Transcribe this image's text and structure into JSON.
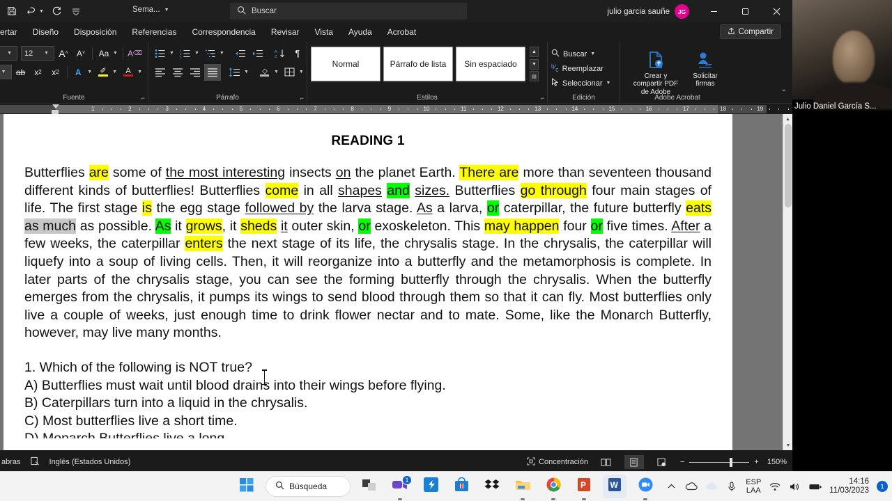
{
  "window": {
    "app": "Microsoft Word",
    "doc_title": "Sema...",
    "account_name": "julio garcia sauñe",
    "avatar_initials": "JG",
    "search_placeholder": "Buscar",
    "share_label": "Compartir",
    "minimize": "–",
    "restore": "❐",
    "close": "✕"
  },
  "tabs": [
    {
      "label": "sertar"
    },
    {
      "label": "Diseño"
    },
    {
      "label": "Disposición"
    },
    {
      "label": "Referencias"
    },
    {
      "label": "Correspondencia"
    },
    {
      "label": "Revisar"
    },
    {
      "label": "Vista"
    },
    {
      "label": "Ayuda"
    },
    {
      "label": "Acrobat"
    }
  ],
  "ribbon": {
    "font_group": {
      "label": "Fuente",
      "font_size": "12",
      "grow_font": "A",
      "shrink_font": "A",
      "change_case": "Aa",
      "clear_format": "A",
      "strikethrough": "ab",
      "subscript": "x₂",
      "superscript": "x²",
      "text_effects": "A",
      "highlight": "A",
      "font_color": "A"
    },
    "paragraph_group": {
      "label": "Párrafo"
    },
    "styles_group": {
      "label": "Estilos",
      "styles": [
        {
          "name": "Normal"
        },
        {
          "name": "Párrafo de lista"
        },
        {
          "name": "Sin espaciado"
        }
      ]
    },
    "edition_group": {
      "label": "Edición",
      "items": [
        {
          "label": "Buscar",
          "icon": "search-icon",
          "caret": true
        },
        {
          "label": "Reemplazar",
          "icon": "replace-icon",
          "caret": false
        },
        {
          "label": "Seleccionar",
          "icon": "select-icon",
          "caret": true
        }
      ]
    },
    "acrobat_group": {
      "label": "Adobe Acrobat",
      "buttons": [
        {
          "label": "Crear y compartir PDF de Adobe",
          "icon": "pdf-upload-icon"
        },
        {
          "label": "Solicitar firmas",
          "icon": "signature-icon"
        }
      ]
    }
  },
  "ruler": {
    "numbers": [
      "1",
      "2",
      "3",
      "4",
      "5",
      "6",
      "7",
      "8",
      "9",
      "10",
      "11",
      "12",
      "13",
      "14",
      "15",
      "16",
      "17",
      "18",
      "19"
    ]
  },
  "document": {
    "heading": "READING 1",
    "paragraph_runs": [
      {
        "t": "Butterflies ",
        "s": ""
      },
      {
        "t": "are",
        "s": "y"
      },
      {
        "t": " some of ",
        "s": ""
      },
      {
        "t": "the most interesting",
        "s": "u"
      },
      {
        "t": " insects ",
        "s": ""
      },
      {
        "t": "on",
        "s": "u"
      },
      {
        "t": " the planet Earth. ",
        "s": ""
      },
      {
        "t": "There are",
        "s": "y"
      },
      {
        "t": " more than seventeen thousand different kinds of butterflies! Butterflies ",
        "s": ""
      },
      {
        "t": "come",
        "s": "y"
      },
      {
        "t": " in all ",
        "s": ""
      },
      {
        "t": "shapes",
        "s": "u"
      },
      {
        "t": " ",
        "s": ""
      },
      {
        "t": "and",
        "s": "g"
      },
      {
        "t": " ",
        "s": ""
      },
      {
        "t": "sizes.",
        "s": "u"
      },
      {
        "t": " Butterflies ",
        "s": ""
      },
      {
        "t": "go through",
        "s": "y"
      },
      {
        "t": " four main stages of life. The first stage ",
        "s": ""
      },
      {
        "t": "is",
        "s": "y"
      },
      {
        "t": " the egg stage ",
        "s": ""
      },
      {
        "t": "followed by",
        "s": "u"
      },
      {
        "t": " the larva stage. ",
        "s": ""
      },
      {
        "t": "As",
        "s": "u"
      },
      {
        "t": " a larva, ",
        "s": ""
      },
      {
        "t": "or",
        "s": "g"
      },
      {
        "t": " caterpillar, the future butterfly ",
        "s": ""
      },
      {
        "t": "eats",
        "s": "y"
      },
      {
        "t": " ",
        "s": ""
      },
      {
        "t": "as much",
        "s": "gr"
      },
      {
        "t": " as possible. ",
        "s": ""
      },
      {
        "t": "As",
        "s": "g"
      },
      {
        "t": " it ",
        "s": ""
      },
      {
        "t": "grows",
        "s": "y"
      },
      {
        "t": ", it ",
        "s": ""
      },
      {
        "t": "sheds",
        "s": "y"
      },
      {
        "t": " ",
        "s": ""
      },
      {
        "t": "it",
        "s": "u"
      },
      {
        "t": " outer skin, ",
        "s": ""
      },
      {
        "t": "or",
        "s": "g"
      },
      {
        "t": " exoskeleton. This ",
        "s": ""
      },
      {
        "t": "may happen",
        "s": "y"
      },
      {
        "t": " four ",
        "s": ""
      },
      {
        "t": "or",
        "s": "g"
      },
      {
        "t": " five times. ",
        "s": ""
      },
      {
        "t": "After",
        "s": "u"
      },
      {
        "t": " a few weeks, the caterpillar ",
        "s": ""
      },
      {
        "t": "enters",
        "s": "y"
      },
      {
        "t": " the next stage of its life, the chrysalis stage. In the chrysalis, the caterpillar will liquefy into a soup of living cells. Then, it will reorganize into a butterfly and the metamorphosis is complete. In later parts of the chrysalis stage, you can see the forming butterfly through the chrysalis. When the butterfly emerges from the chrysalis, it pumps its wings to send blood through them so that it can fly. Most butterflies only live a couple of weeks, just enough time to drink flower nectar and to mate. Some, like the Monarch Butterfly, however, may live many months.",
        "s": ""
      }
    ],
    "questions": [
      "1. Which of the following is NOT true?",
      "A) Butterflies must wait until blood drains into their wings before flying.",
      "B) Caterpillars turn into a liquid in the chrysalis.",
      "C) Most butterflies live a short time.",
      "D) Monarch Butterflies live a long"
    ]
  },
  "statusbar": {
    "words": "abras",
    "language": "Inglés (Estados Unidos)",
    "focus": "Concentración",
    "zoom": "150%",
    "zoom_out": "−",
    "zoom_in": "+"
  },
  "webcam": {
    "participant_name": "Julio Daniel García S..."
  },
  "taskbar": {
    "search_label": "Búsqueda",
    "items": [
      {
        "name": "start-button",
        "icon": "windows-logo-icon"
      },
      {
        "name": "search",
        "icon": "search-icon"
      },
      {
        "name": "taskview-button",
        "icon": "task-view-icon"
      },
      {
        "name": "teams-button",
        "icon": "teams-icon",
        "badge": "1"
      },
      {
        "name": "store-dev-button",
        "icon": "sharepoint-icon"
      },
      {
        "name": "store-button",
        "icon": "microsoft-store-icon"
      },
      {
        "name": "dropbox-button",
        "icon": "dropbox-icon"
      },
      {
        "name": "explorer-button",
        "icon": "file-explorer-icon"
      },
      {
        "name": "chrome-button",
        "icon": "chrome-icon"
      },
      {
        "name": "powerpoint-button",
        "icon": "powerpoint-icon"
      },
      {
        "name": "word-button",
        "icon": "word-icon"
      },
      {
        "name": "zoom-button",
        "icon": "zoom-icon"
      }
    ],
    "tray": {
      "overflow": "˄",
      "language_line1": "ESP",
      "language_line2": "LAA",
      "time": "14:16",
      "date": "11/03/2023",
      "notification_count": "1"
    }
  },
  "colors": {
    "ribbon_bg": "#1b1b1b",
    "accent_pink": "#e3008c",
    "highlight_yellow": "#ffff00",
    "highlight_green": "#00ff00",
    "highlight_gray": "#c8c8c8",
    "taskbar_bg": "#f3f3f3",
    "word_blue": "#2b579a"
  }
}
